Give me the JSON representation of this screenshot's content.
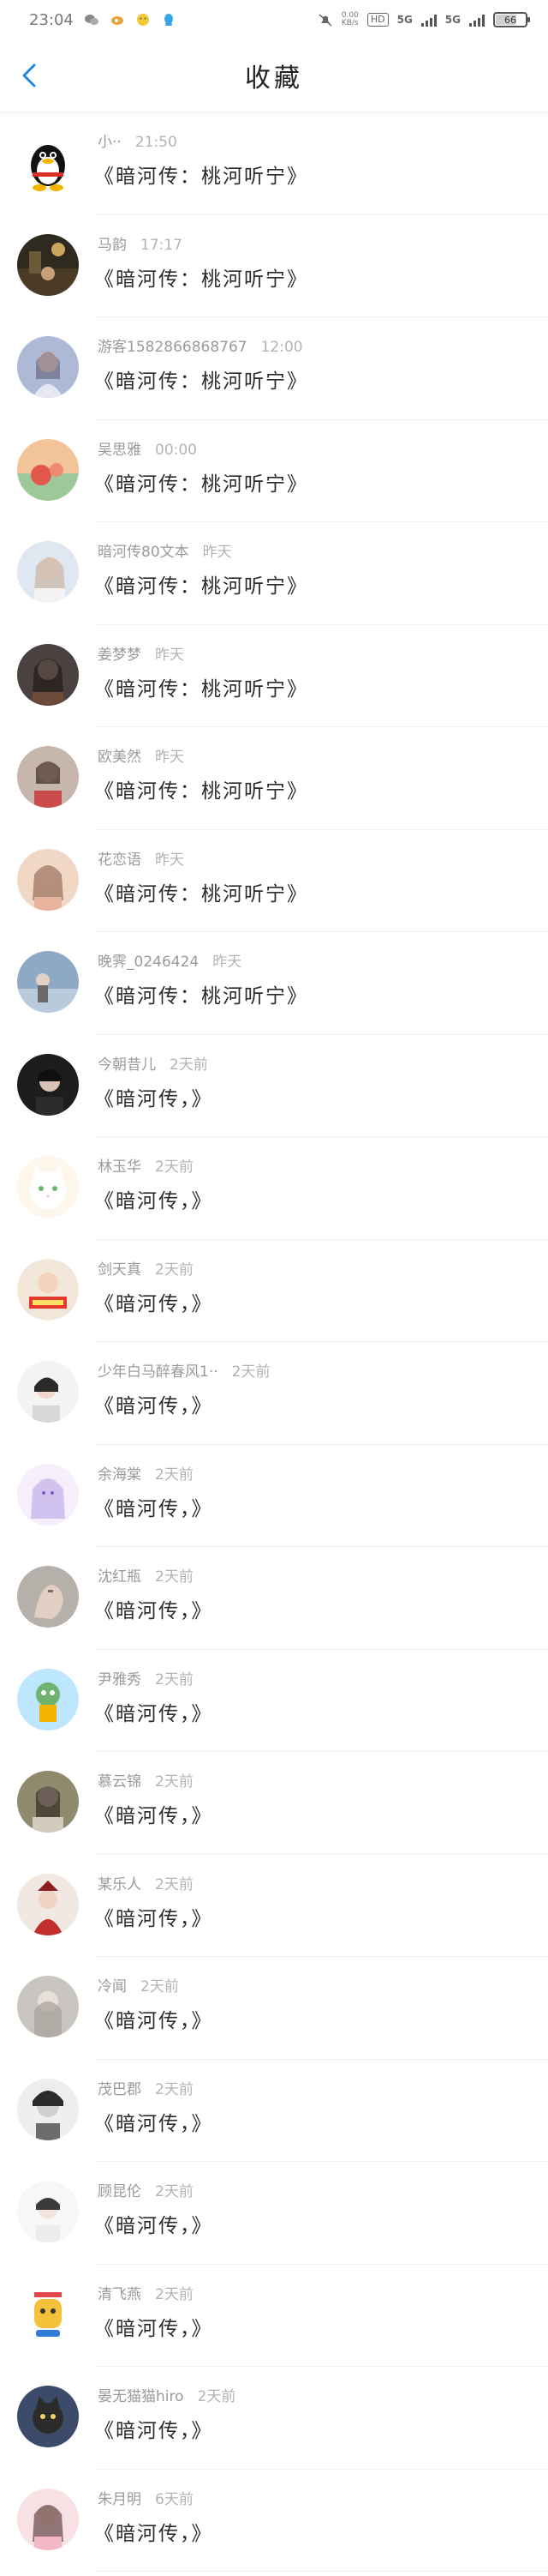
{
  "status_bar": {
    "time": "23:04",
    "hd": "HD",
    "net_speed": "0.00",
    "net_unit": "KB/s",
    "sig1": "5G",
    "sig2": "5G",
    "battery": "66"
  },
  "header": {
    "title": "收藏"
  },
  "list": [
    {
      "name": "小··",
      "time": "21:50",
      "message": "《暗河传：桃河听宁》",
      "avatar": "penguin"
    },
    {
      "name": "马韵",
      "time": "17:17",
      "message": "《暗河传：桃河听宁》",
      "avatar": "night-street"
    },
    {
      "name": "游客1582866868767",
      "time": "12:00",
      "message": "《暗河传：桃河听宁》",
      "avatar": "girl-blue"
    },
    {
      "name": "吴思雅",
      "time": "00:00",
      "message": "《暗河传：桃河听宁》",
      "avatar": "sunset-flower"
    },
    {
      "name": "暗河传80文本",
      "time": "昨天",
      "message": "《暗河传：桃河听宁》",
      "avatar": "girl-light"
    },
    {
      "name": "姜梦梦",
      "time": "昨天",
      "message": "《暗河传：桃河听宁》",
      "avatar": "girl-dark"
    },
    {
      "name": "欧美然",
      "time": "昨天",
      "message": "《暗河传：桃河听宁》",
      "avatar": "girl-red"
    },
    {
      "name": "花恋语",
      "time": "昨天",
      "message": "《暗河传：桃河听宁》",
      "avatar": "girl-peach"
    },
    {
      "name": "晚霁_0246424",
      "time": "昨天",
      "message": "《暗河传：桃河听宁》",
      "avatar": "sky-blue"
    },
    {
      "name": "今朝昔儿",
      "time": "2天前",
      "message": "《暗河传，》",
      "avatar": "dark-boy"
    },
    {
      "name": "林玉华",
      "time": "2天前",
      "message": "《暗河传，》",
      "avatar": "white-cat"
    },
    {
      "name": "剑天真",
      "time": "2天前",
      "message": "《暗河传，》",
      "avatar": "sticker-red"
    },
    {
      "name": "少年白马醉春风1··",
      "time": "2天前",
      "message": "《暗河传，》",
      "avatar": "boy-light"
    },
    {
      "name": "余海棠",
      "time": "2天前",
      "message": "《暗河传，》",
      "avatar": "anime-pink"
    },
    {
      "name": "沈红瓶",
      "time": "2天前",
      "message": "《暗河传，》",
      "avatar": "hand-gray"
    },
    {
      "name": "尹雅秀",
      "time": "2天前",
      "message": "《暗河传，》",
      "avatar": "cartoon-green"
    },
    {
      "name": "慕云锦",
      "time": "2天前",
      "message": "《暗河传，》",
      "avatar": "girl-olive"
    },
    {
      "name": "某乐人",
      "time": "2天前",
      "message": "《暗河传，》",
      "avatar": "red-warrior"
    },
    {
      "name": "冷闻",
      "time": "2天前",
      "message": "《暗河传，》",
      "avatar": "sketch-gray"
    },
    {
      "name": "茂巴郡",
      "time": "2天前",
      "message": "《暗河传，》",
      "avatar": "bw-portrait"
    },
    {
      "name": "顾昆伦",
      "time": "2天前",
      "message": "《暗河传，》",
      "avatar": "boy-pale"
    },
    {
      "name": "清飞燕",
      "time": "2天前",
      "message": "《暗河传，》",
      "avatar": "cartoon-yellow"
    },
    {
      "name": "晏无猫猫hiro",
      "time": "2天前",
      "message": "《暗河传，》",
      "avatar": "cat-dark"
    },
    {
      "name": "朱月明",
      "time": "6天前",
      "message": "《暗河传，》",
      "avatar": "girl-pink"
    }
  ],
  "colors": {
    "accent": "#1e88e5",
    "divider": "#f0f0f0",
    "meta_text": "#9a9a9a",
    "message_text": "#2b2b2b"
  },
  "icons": {
    "back": "chevron-left-icon",
    "status": [
      "wechat-icon",
      "weibo-icon",
      "emoji-icon",
      "qq-icon",
      "mute-icon"
    ]
  }
}
